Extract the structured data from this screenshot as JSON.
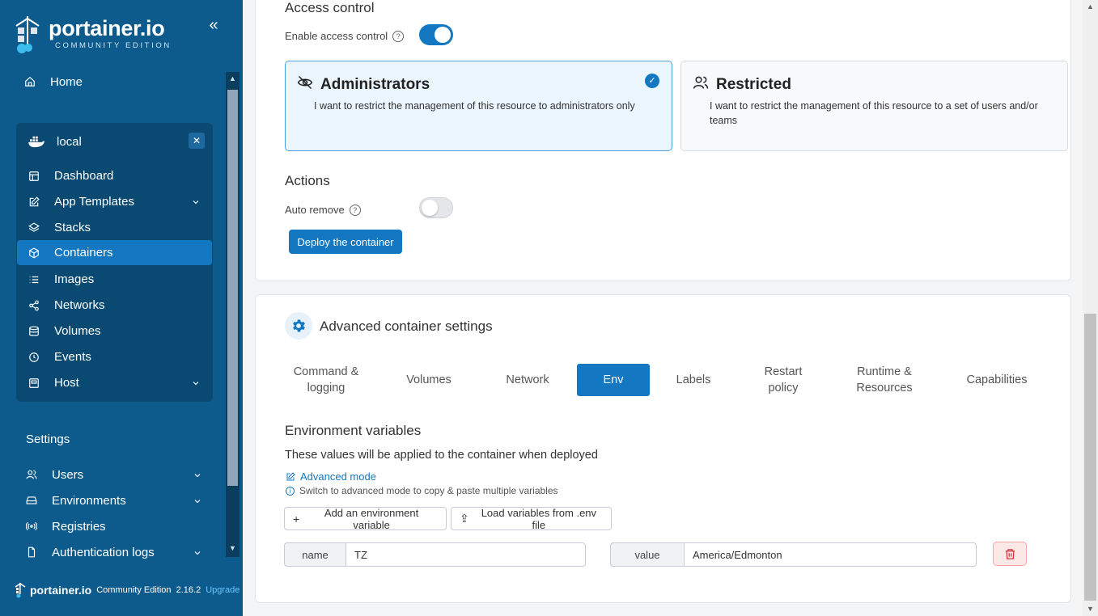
{
  "sidebar": {
    "logo_text": "portainer.io",
    "logo_sub": "COMMUNITY EDITION",
    "home": "Home",
    "environment": {
      "name": "local",
      "items": [
        {
          "label": "Dashboard",
          "icon": "dashboard-icon"
        },
        {
          "label": "App Templates",
          "icon": "edit-icon",
          "expandable": true
        },
        {
          "label": "Stacks",
          "icon": "layers-icon"
        },
        {
          "label": "Containers",
          "icon": "box-icon",
          "active": true
        },
        {
          "label": "Images",
          "icon": "list-icon"
        },
        {
          "label": "Networks",
          "icon": "share-icon"
        },
        {
          "label": "Volumes",
          "icon": "database-icon"
        },
        {
          "label": "Events",
          "icon": "clock-icon"
        },
        {
          "label": "Host",
          "icon": "server-icon",
          "expandable": true
        }
      ]
    },
    "settings_heading": "Settings",
    "settings_items": [
      {
        "label": "Users",
        "icon": "users-icon",
        "expandable": true
      },
      {
        "label": "Environments",
        "icon": "hdd-icon",
        "expandable": true
      },
      {
        "label": "Registries",
        "icon": "radio-icon"
      },
      {
        "label": "Authentication logs",
        "icon": "file-icon",
        "expandable": true
      }
    ],
    "footer": {
      "logo": "portainer.io",
      "edition": "Community Edition",
      "version": "2.16.2",
      "upgrade": "Upgrade"
    }
  },
  "access_control": {
    "heading": "Access control",
    "enable_label": "Enable access control",
    "enabled": true,
    "cards": [
      {
        "title": "Administrators",
        "desc": "I want to restrict the management of this resource to administrators only",
        "selected": true
      },
      {
        "title": "Restricted",
        "desc": "I want to restrict the management of this resource to a set of users and/or teams",
        "selected": false
      }
    ]
  },
  "actions": {
    "heading": "Actions",
    "auto_remove_label": "Auto remove",
    "auto_remove": false,
    "deploy_label": "Deploy the container"
  },
  "advanced": {
    "title": "Advanced container settings",
    "tabs": [
      {
        "label": "Command & logging"
      },
      {
        "label": "Volumes"
      },
      {
        "label": "Network"
      },
      {
        "label": "Env",
        "active": true
      },
      {
        "label": "Labels"
      },
      {
        "label": "Restart policy"
      },
      {
        "label": "Runtime & Resources"
      },
      {
        "label": "Capabilities"
      }
    ],
    "env": {
      "heading": "Environment variables",
      "description": "These values will be applied to the container when deployed",
      "advanced_mode": "Advanced mode",
      "advanced_hint": "Switch to advanced mode to copy & paste multiple variables",
      "add_label": "Add an environment variable",
      "load_label": "Load variables from .env file",
      "variables": [
        {
          "name_label": "name",
          "name": "TZ",
          "value_label": "value",
          "value": "America/Edmonton"
        }
      ]
    }
  },
  "colors": {
    "sidebar": "#0d5b8c",
    "accent": "#1377c2",
    "danger": "#d83030"
  }
}
